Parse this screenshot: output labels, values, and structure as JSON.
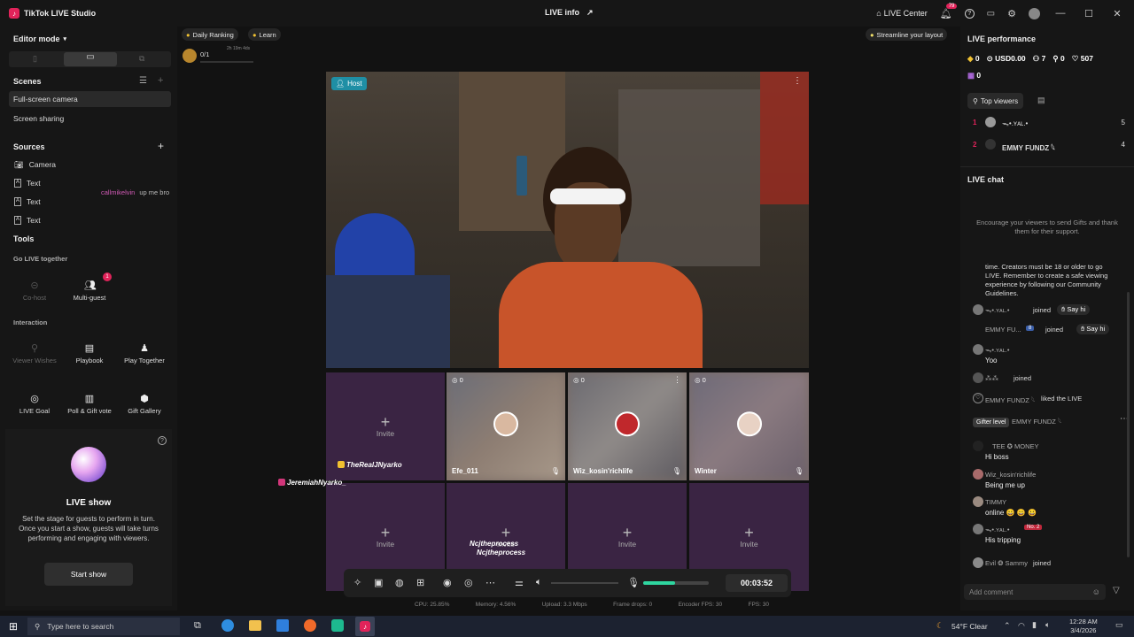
{
  "titlebar": {
    "app_name": "TikTok LIVE Studio",
    "center_title": "LIVE info",
    "live_center": "LIVE Center",
    "notif_count": "79"
  },
  "left": {
    "editor_mode": "Editor mode",
    "scenes_title": "Scenes",
    "scenes": [
      "Full-screen camera",
      "Screen sharing"
    ],
    "sources_title": "Sources",
    "sources": [
      "Camera",
      "Text",
      "Text",
      "Text"
    ],
    "tools_title": "Tools",
    "go_live_together": "Go LIVE together",
    "cohost": "Co-host",
    "multiguest": "Multi-guest",
    "multiguest_badge": "1",
    "interaction": "Interaction",
    "viewer_wishes": "Viewer Wishes",
    "playbook": "Playbook",
    "play_together": "Play Together",
    "live_goal": "LIVE Goal",
    "poll_gift_vote": "Poll & Gift vote",
    "gift_gallery": "Gift Gallery",
    "live_show_title": "LIVE show",
    "live_show_desc": "Set the stage for guests to perform in turn. Once you start a show, guests will take turns performing and engaging with viewers.",
    "start_show": "Start show"
  },
  "center": {
    "daily_ranking": "Daily Ranking",
    "learn": "Learn",
    "rank_value": "0/1",
    "rank_timer": "2h 19m 4ds",
    "streamline": "Streamline your layout",
    "overlay_callmikelvin": "callmikelvin",
    "overlay_upmebro": "up me bro",
    "host_label": "Host",
    "invite": "Invite",
    "guests": [
      {
        "name": "Efe_011",
        "count": "0"
      },
      {
        "name": "Wiz_kosin'richlife",
        "count": "0"
      },
      {
        "name": "Winter",
        "count": "0"
      }
    ],
    "overlay_realjnyarko": "TheRealJNyarko",
    "overlay_jeremiah": "JeremiahNyarko_",
    "overlay_ncj1": "Ncjtheprocess",
    "overlay_ncj2": "Ncjtheprocess",
    "timer": "00:03:52",
    "stats": {
      "cpu": "CPU: 25.85%",
      "memory": "Memory: 4.56%",
      "upload": "Upload: 3.3 Mbps",
      "frame_drops": "Frame drops: 0",
      "encoder_fps": "Encoder FPS: 30",
      "fps": "FPS: 30"
    }
  },
  "right": {
    "perf_title": "LIVE performance",
    "diamonds": "0",
    "usd": "USD0.00",
    "viewers": "7",
    "new_followers": "0",
    "likes": "507",
    "extra": "0",
    "top_viewers": "Top viewers",
    "top_list": [
      {
        "rank": "1",
        "name": "ᯓ•.ʏᴀʟ.•",
        "score": "5"
      },
      {
        "rank": "2",
        "name": "EMMY FUNDZ 𓆩",
        "score": "4"
      }
    ],
    "chat_title": "LIVE chat",
    "encourage": "Encourage your viewers to send Gifts and thank them for their support.",
    "system_msg": "time. Creators must be 18 or older to go LIVE. Remember to create a safe viewing experience by following our Community Guidelines.",
    "say_hi": "Say hi",
    "chat": [
      {
        "name": "ᯓ•.ʏᴀʟ.•",
        "msg": "joined"
      },
      {
        "name": "EMMY FU...",
        "badge": "8",
        "msg": "joined"
      },
      {
        "name": "ᯓ•.ʏᴀʟ.•",
        "msg": "Yoo"
      },
      {
        "name": "⁂⁂",
        "msg": "joined"
      },
      {
        "name": "EMMY FUNDZ 𓆩",
        "msg": "liked the LIVE"
      },
      {
        "name": "EMMY FUNDZ 𓆩",
        "msg": ""
      },
      {
        "name": "TEE ✪ MONEY",
        "msg": "Hi boss"
      },
      {
        "name": "Wiz_kosin'richlife",
        "msg": "Being me up"
      },
      {
        "name": "TIMMY",
        "msg": "online 😀 😀 😀"
      },
      {
        "name": "ᯓ•.ʏᴀʟ.•",
        "badge": "No. 2",
        "msg": "His tripping"
      },
      {
        "name": "Evil ❂ Sammy",
        "msg": "joined"
      }
    ],
    "tooltip": "Gifter level",
    "add_comment": "Add comment"
  },
  "taskbar": {
    "search": "Type here to search",
    "weather": "54°F  Clear",
    "time": "12:28 AM",
    "date": "3/4/2026"
  },
  "colors": {
    "accent": "#e1235a",
    "invite_bg": "#3a2443",
    "panel": "#161616"
  }
}
